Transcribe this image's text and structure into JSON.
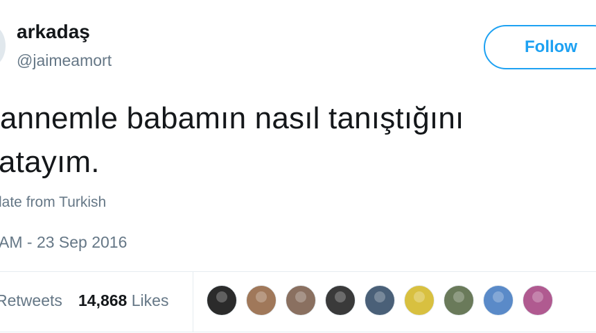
{
  "header": {
    "display_name": "arkadaş",
    "handle": "@jaimeamort",
    "follow_label": "Follow"
  },
  "tweet": {
    "line1": " annemle babamın nasıl tanıştığını",
    "line2": "atayım.",
    "translate_label": "late from Turkish",
    "timestamp": "AM - 23 Sep 2016"
  },
  "stats": {
    "retweets_label": "Retweets",
    "likes_count": "14,868",
    "likes_label": "Likes"
  },
  "likers": [
    {
      "name": "liker-avatar",
      "color": "#2b2b2b"
    },
    {
      "name": "liker-avatar",
      "color": "#a0785a"
    },
    {
      "name": "liker-avatar",
      "color": "#8a7060"
    },
    {
      "name": "liker-avatar",
      "color": "#3a3a3a"
    },
    {
      "name": "liker-avatar",
      "color": "#4a6078"
    },
    {
      "name": "liker-avatar",
      "color": "#d8c040"
    },
    {
      "name": "liker-avatar",
      "color": "#6a7a5a"
    },
    {
      "name": "liker-avatar",
      "color": "#5a8ac8"
    },
    {
      "name": "liker-avatar",
      "color": "#b05a90"
    }
  ],
  "colors": {
    "accent": "#1da1f2",
    "secondary_text": "#657786",
    "primary_text": "#14171a"
  }
}
